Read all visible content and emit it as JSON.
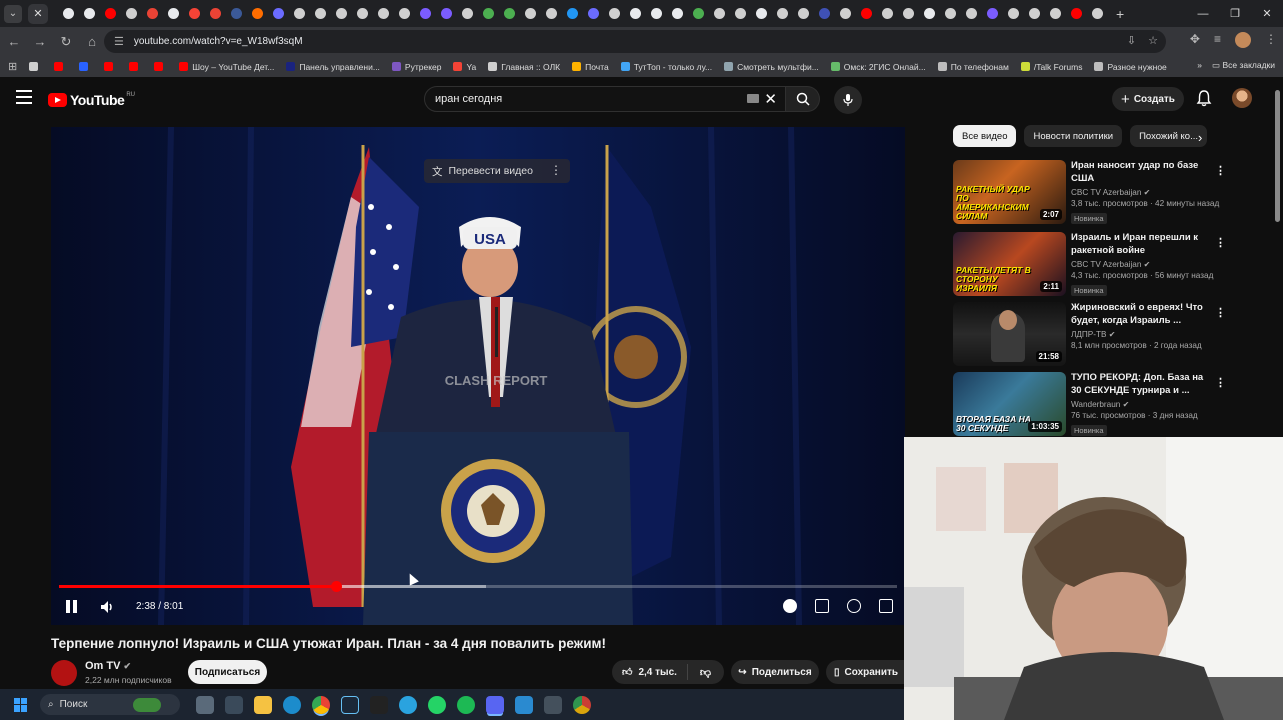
{
  "browser": {
    "url": "youtube.com/watch?v=e_W18wf3sqM",
    "tab_favicons": [
      "#e8eaed",
      "#e8eaed",
      "#ff0000",
      "#cfcfcf",
      "#ea4335",
      "#e8eaed",
      "#f44336",
      "#ea4335",
      "#3b5998",
      "#ff6d00",
      "#6b6bff",
      "#cfcfcf",
      "#cfcfcf",
      "#cfcfcf",
      "#cfcfcf",
      "#cfcfcf",
      "#cfcfcf",
      "#7b5cff",
      "#7b5cff",
      "#cfcfcf",
      "#4caf50",
      "#4caf50",
      "#cfcfcf",
      "#cfcfcf",
      "#2196f3",
      "#6b6bff",
      "#cfcfcf",
      "#e8eaed",
      "#e8eaed",
      "#e8eaed",
      "#4caf50",
      "#cfcfcf",
      "#cfcfcf",
      "#e8eaed",
      "#cfcfcf",
      "#cfcfcf",
      "#3f51b5",
      "#cfcfcf",
      "#ff0000",
      "#cfcfcf",
      "#cfcfcf",
      "#e8eaed",
      "#cfcfcf",
      "#cfcfcf",
      "#7b5cff",
      "#cfcfcf",
      "#cfcfcf",
      "#cfcfcf",
      "#ff0000",
      "#cfcfcf"
    ],
    "bookmarks": [
      {
        "label": "",
        "color": "#cfcfcf"
      },
      {
        "label": "",
        "color": "#ff0000"
      },
      {
        "label": "",
        "color": "#2962ff"
      },
      {
        "label": "",
        "color": "#ff0000"
      },
      {
        "label": "",
        "color": "#ff0000"
      },
      {
        "label": "",
        "color": "#ff0000"
      },
      {
        "label": "Шоу – YouTube Дет...",
        "color": "#ff0000"
      },
      {
        "label": "Панель управлени...",
        "color": "#1a237e"
      },
      {
        "label": "Рутрекер",
        "color": "#7e57c2"
      },
      {
        "label": "Ya",
        "color": "#f44336"
      },
      {
        "label": "Главная :: ОЛК",
        "color": "#cfcfcf"
      },
      {
        "label": "Почта",
        "color": "#ffb300"
      },
      {
        "label": "ТутТоп - только лу...",
        "color": "#42a5f5"
      },
      {
        "label": "Смотреть мультфи...",
        "color": "#90a4ae"
      },
      {
        "label": "Омск: 2ГИС Онлай...",
        "color": "#66bb6a"
      },
      {
        "label": "По телефонам",
        "color": "#bdbdbd"
      },
      {
        "label": "/Talk Forums",
        "color": "#cddc39"
      },
      {
        "label": "Разное нужное",
        "color": "#bdbdbd"
      }
    ],
    "all_bookmarks": "Все закладки"
  },
  "header": {
    "logo_text": "YouTube",
    "region": "RU",
    "search_query": "иран сегодня",
    "create_label": "Создать"
  },
  "player": {
    "translate_label": "Перевести видео",
    "current_time": "2:38",
    "duration": "8:01",
    "time_display": "2:38 / 8:01",
    "played_fraction": 0.33,
    "buffered_fraction": 0.51,
    "watermark": "CLASH REPORT",
    "hat_text": "USA"
  },
  "video": {
    "title": "Терпение лопнуло! Израиль и США утюжат Иран. План - за 4 дня повалить режим!",
    "channel": "Om TV",
    "subscribers": "2,22 млн подписчиков",
    "subscribe_label": "Подписаться",
    "likes": "2,4 тыс.",
    "share_label": "Поделиться",
    "save_label": "Сохранить"
  },
  "sidebar": {
    "chips": [
      "Все видео",
      "Новости политики",
      "Похожий ко..."
    ],
    "recommendations": [
      {
        "title": "Иран наносит удар по базе США",
        "channel": "CBC TV Azerbaijan",
        "views": "3,8 тыс. просмотров · 42 минуты назад",
        "badge": "Новинка",
        "duration": "2:07",
        "thumb_caption": "РАКЕТНЫЙ УДАР ПО АМЕРИКАНСКИМ СИЛАМ"
      },
      {
        "title": "Израиль и Иран перешли к ракетной войне",
        "channel": "CBC TV Azerbaijan",
        "views": "4,3 тыс. просмотров · 56 минут назад",
        "badge": "Новинка",
        "duration": "2:11",
        "thumb_caption": "РАКЕТЫ ЛЕТЯТ В СТОРОНУ ИЗРАИЛЯ"
      },
      {
        "title": "Жириновский о евреях! Что будет, когда Израиль ...",
        "channel": "ЛДПР-ТВ",
        "views": "8,1 млн просмотров · 2 года назад",
        "badge": "",
        "duration": "21:58",
        "thumb_caption": ""
      },
      {
        "title": "ТУПО РЕКОРД: Доп. База на 30 СЕКУНДЕ турнира и ...",
        "channel": "Wanderbraun",
        "views": "76 тыс. просмотров · 3 дня назад",
        "badge": "Новинка",
        "duration": "1:03:35",
        "thumb_caption": "ВТОРАЯ БАЗА НА 30 СЕКУНДЕ"
      }
    ]
  },
  "taskbar": {
    "search_label": "Поиск"
  }
}
